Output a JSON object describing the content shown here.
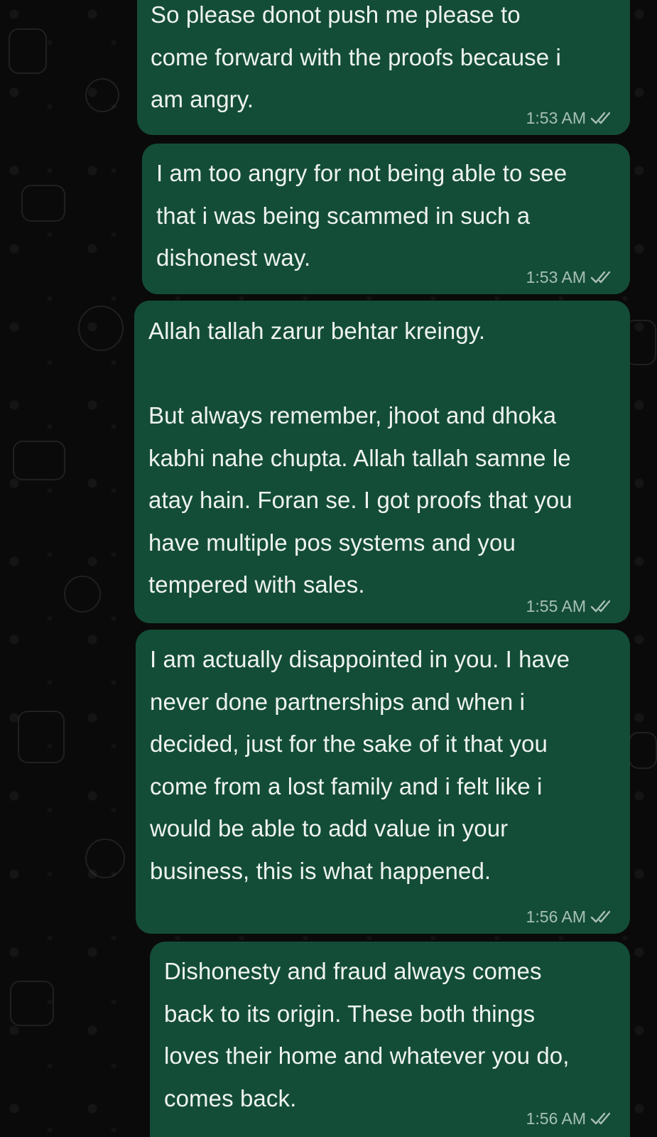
{
  "messages": [
    {
      "text": "So please donot push me please to\ncome forward with the proofs because i\nam angry.",
      "time": "1:53 AM",
      "status_icon": "double-check-icon"
    },
    {
      "text": "I am too angry for not being able to see\nthat i was being scammed in such a\ndishonest way.",
      "time": "1:53 AM",
      "status_icon": "double-check-icon"
    },
    {
      "text": "Allah tallah zarur behtar kreingy.\n\nBut always remember, jhoot and dhoka\nkabhi nahe chupta. Allah tallah samne le\natay hain. Foran se. I got proofs that you\nhave multiple pos systems and you\ntempered with sales.",
      "time": "1:55 AM",
      "status_icon": "double-check-icon"
    },
    {
      "text": "I am actually disappointed in you. I have\nnever done partnerships and when i\ndecided, just for the sake of it that you\ncome from a lost family and i felt like i\nwould be able to add value in your\nbusiness, this is what happened.",
      "time": "1:56 AM",
      "status_icon": "double-check-icon"
    },
    {
      "text": "Dishonesty and fraud always comes\nback to its origin. These both things\nloves their home and whatever you do,\ncomes back.",
      "time": "1:56 AM",
      "status_icon": "double-check-icon"
    }
  ],
  "colors": {
    "background": "#0b0b0b",
    "outgoing_bubble": "#144d37",
    "message_text": "#eef3f0",
    "meta_text": "#a9bfb5"
  }
}
